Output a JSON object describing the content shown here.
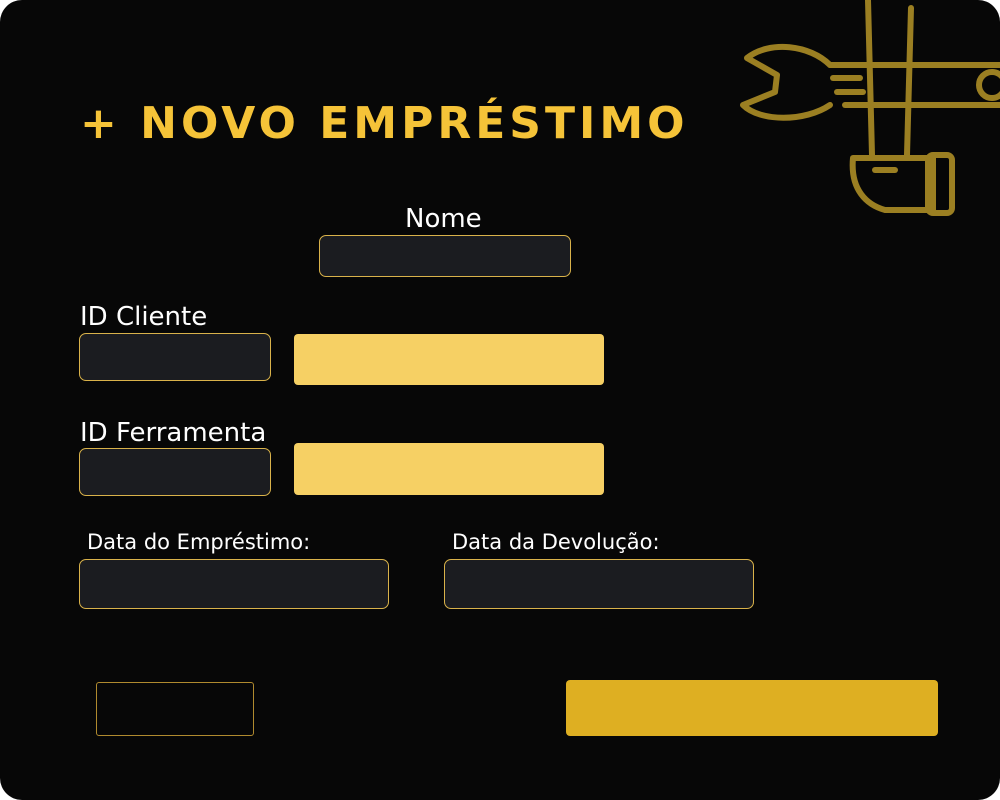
{
  "header": {
    "title": "+ NOVO EMPRÉSTIMO",
    "decoration_icon": "wrench-hammer-icon"
  },
  "form": {
    "nome": {
      "label": "Nome",
      "value": ""
    },
    "id_cliente": {
      "label": "ID Cliente",
      "value": "",
      "lookup_label": ""
    },
    "id_ferramenta": {
      "label": "ID Ferramenta",
      "value": "",
      "lookup_label": ""
    },
    "data_emprestimo": {
      "label": "Data do Empréstimo:",
      "value": ""
    },
    "data_devolucao": {
      "label": "Data da Devolução:",
      "value": ""
    }
  },
  "actions": {
    "cancel_label": "",
    "confirm_label": ""
  },
  "colors": {
    "background": "#070707",
    "accent": "#f5c338",
    "field_background": "#1b1c20",
    "field_border": "#d9b24a",
    "lookup_button": "#f6d064",
    "confirm_button": "#deaf22",
    "icon_stroke": "#9b7f22"
  }
}
